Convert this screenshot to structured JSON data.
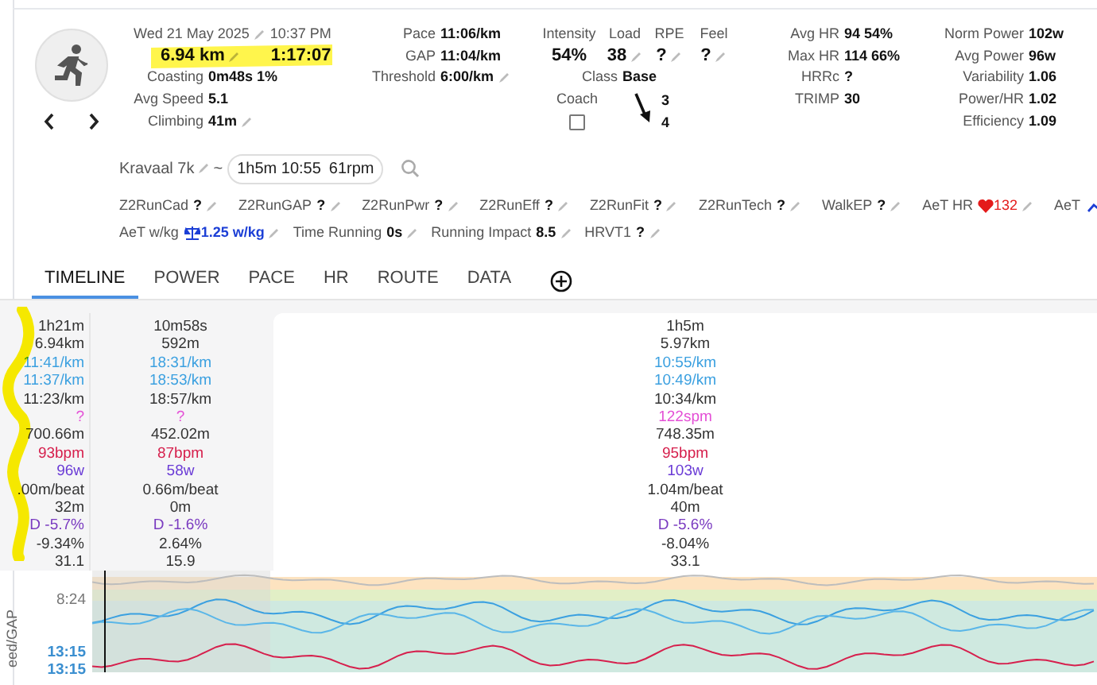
{
  "activity": {
    "date": "Wed 21 May 2025",
    "time": "10:37 PM",
    "distance": "6.94 km",
    "duration": "1:17:07",
    "stats": [
      {
        "label": "Coasting",
        "value": "0m48s 1%",
        "editable": false
      },
      {
        "label": "Avg Speed",
        "value": "5.1",
        "editable": false
      },
      {
        "label": "Climbing",
        "value": "41m",
        "editable": true
      }
    ]
  },
  "pace": [
    {
      "label": "Pace",
      "value": "11:06/km",
      "editable": false
    },
    {
      "label": "GAP",
      "value": "11:04/km",
      "editable": false
    },
    {
      "label": "Threshold",
      "value": "6:00/km",
      "editable": true
    }
  ],
  "load": [
    {
      "label": "Intensity",
      "value": "54%",
      "editable": false
    },
    {
      "label": "Load",
      "value": "38",
      "editable": true
    },
    {
      "label": "RPE",
      "value": "?",
      "editable": true
    },
    {
      "label": "Feel",
      "value": "?",
      "editable": true
    }
  ],
  "class": {
    "label": "Class",
    "value": "Base"
  },
  "coach": {
    "label": "Coach",
    "checked": false
  },
  "side_numbers": [
    "3",
    "4"
  ],
  "heart_rate": [
    {
      "label": "Avg HR",
      "value": "94   54%"
    },
    {
      "label": "Max HR",
      "value": "114 66%"
    },
    {
      "label": "HRRc",
      "value": "?"
    },
    {
      "label": "TRIMP",
      "value": "30"
    }
  ],
  "power": [
    {
      "label": "Norm Power",
      "value": "102w"
    },
    {
      "label": "Avg Power",
      "value": "96w"
    },
    {
      "label": "Variability",
      "value": "1.06"
    },
    {
      "label": "Power/HR",
      "value": "1.02"
    },
    {
      "label": "Efficiency",
      "value": "1.09"
    }
  ],
  "name": {
    "value": "Kravaal 7k",
    "separator": "~",
    "summary": [
      "1h5m 10:55",
      "61rpm"
    ]
  },
  "custom_fields": [
    [
      {
        "kind": "plain",
        "label": "Z2RunCad",
        "value": "?"
      },
      {
        "kind": "plain",
        "label": "Z2RunGAP",
        "value": "?"
      },
      {
        "kind": "plain",
        "label": "Z2RunPwr",
        "value": "?"
      },
      {
        "kind": "plain",
        "label": "Z2RunEff",
        "value": "?"
      },
      {
        "kind": "plain",
        "label": "Z2RunFit",
        "value": "?"
      },
      {
        "kind": "plain",
        "label": "Z2RunTech",
        "value": "?"
      },
      {
        "kind": "plain",
        "label": "WalkEP",
        "value": "?"
      },
      {
        "kind": "heart",
        "label": "AeT HR",
        "value": "132"
      },
      {
        "kind": "trend",
        "label": "AeT"
      }
    ],
    [
      {
        "kind": "scale",
        "label": "AeT w/kg",
        "value": "1.25 w/kg"
      },
      {
        "kind": "plain",
        "label": "Time Running",
        "value": "0s"
      },
      {
        "kind": "plain",
        "label": "Running Impact",
        "value": "8.5"
      },
      {
        "kind": "plain",
        "label": "HRVT1",
        "value": "?"
      }
    ]
  ],
  "tabs": [
    {
      "label": "TIMELINE",
      "selected": true
    },
    {
      "label": "POWER",
      "selected": false
    },
    {
      "label": "PACE",
      "selected": false
    },
    {
      "label": "HR",
      "selected": false
    },
    {
      "label": "ROUTE",
      "selected": false
    },
    {
      "label": "DATA",
      "selected": false
    }
  ],
  "interval_stats": [
    {
      "kind": "plain",
      "cells": [
        "1h21m",
        "10m58s",
        "1h5m"
      ]
    },
    {
      "kind": "plain",
      "cells": [
        "6.94km",
        "592m",
        "5.97km"
      ]
    },
    {
      "kind": "pace",
      "cells": [
        "11:41/km",
        "18:31/km",
        "10:55/km"
      ]
    },
    {
      "kind": "pace",
      "cells": [
        "11:37/km",
        "18:53/km",
        "10:49/km"
      ]
    },
    {
      "kind": "plain",
      "cells": [
        "11:23/km",
        "18:57/km",
        "10:34/km"
      ]
    },
    {
      "kind": "cadence",
      "cells": [
        "?",
        "?",
        "122spm"
      ]
    },
    {
      "kind": "plain",
      "cells": [
        "700.66m",
        "452.02m",
        "748.35m"
      ]
    },
    {
      "kind": "hr",
      "cells": [
        "93bpm",
        "87bpm",
        "95bpm"
      ]
    },
    {
      "kind": "power",
      "cells": [
        "96w",
        "58w",
        "103w"
      ]
    },
    {
      "kind": "plain",
      "cells": [
        ".00m/beat",
        "0.66m/beat",
        "1.04m/beat"
      ]
    },
    {
      "kind": "plain",
      "cells": [
        "32m",
        "0m",
        "40m"
      ]
    },
    {
      "kind": "decoupling",
      "cells": [
        "D -5.7%",
        "D -1.6%",
        "D -5.6%"
      ]
    },
    {
      "kind": "plain",
      "cells": [
        "-9.34%",
        "2.64%",
        "-8.04%"
      ]
    },
    {
      "kind": "plain",
      "cells": [
        "31.1",
        "15.9",
        "33.1"
      ]
    }
  ],
  "chart": {
    "axis_label": "eed/GAP",
    "ticks": [
      {
        "label": "8:24",
        "kind": "plain"
      },
      {
        "label": "13:15",
        "kind": "pace"
      },
      {
        "label": "13:15",
        "kind": "pace"
      }
    ]
  }
}
